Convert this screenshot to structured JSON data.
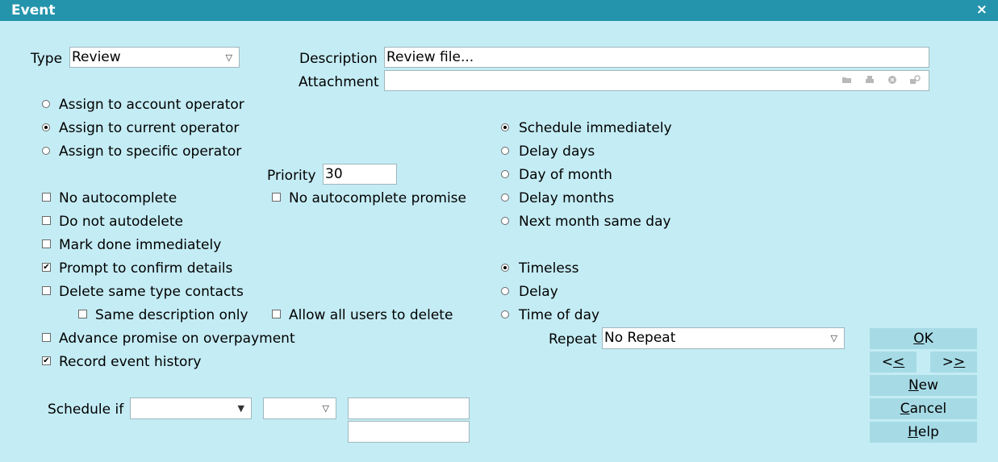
{
  "window": {
    "title": "Event",
    "close_glyph": "×"
  },
  "type": {
    "label": "Type",
    "value": "Review"
  },
  "description": {
    "label": "Description",
    "value": "Review file..."
  },
  "attachment": {
    "label": "Attachment",
    "value": "",
    "icons": [
      "folder-icon",
      "print-icon",
      "clear-icon",
      "search-icon"
    ]
  },
  "assign": [
    {
      "label": "Assign to account operator",
      "selected": false
    },
    {
      "label": "Assign to current operator",
      "selected": true
    },
    {
      "label": "Assign to specific operator",
      "selected": false
    }
  ],
  "priority": {
    "label": "Priority",
    "value": "30"
  },
  "options": {
    "no_autocomplete": {
      "label": "No autocomplete",
      "checked": false
    },
    "no_autocomplete_promise": {
      "label": "No autocomplete promise",
      "checked": false
    },
    "do_not_autodelete": {
      "label": "Do not autodelete",
      "checked": false
    },
    "mark_done": {
      "label": "Mark done immediately",
      "checked": false
    },
    "prompt_confirm": {
      "label": "Prompt to confirm details",
      "checked": true
    },
    "delete_same_type": {
      "label": "Delete same type contacts",
      "checked": false
    },
    "same_description": {
      "label": "Same description only",
      "checked": false
    },
    "allow_all_users": {
      "label": "Allow all users to delete",
      "checked": false
    },
    "advance_promise": {
      "label": "Advance promise on overpayment",
      "checked": false
    },
    "record_history": {
      "label": "Record event history",
      "checked": true
    }
  },
  "schedule": [
    {
      "label": "Schedule immediately",
      "selected": true
    },
    {
      "label": "Delay days",
      "selected": false
    },
    {
      "label": "Day of month",
      "selected": false
    },
    {
      "label": "Delay months",
      "selected": false
    },
    {
      "label": "Next month same day",
      "selected": false
    }
  ],
  "timing": [
    {
      "label": "Timeless",
      "selected": true
    },
    {
      "label": "Delay",
      "selected": false
    },
    {
      "label": "Time of day",
      "selected": false
    }
  ],
  "repeat": {
    "label": "Repeat",
    "value": "No Repeat"
  },
  "schedule_if": {
    "label": "Schedule if",
    "field1": "",
    "field2": "",
    "text1": "",
    "text2": ""
  },
  "buttons": {
    "ok": {
      "pre": "",
      "ul": "O",
      "post": "K"
    },
    "prev": {
      "pre": "<",
      "ul": "<",
      "post": ""
    },
    "next": {
      "pre": ">",
      "ul": ">",
      "post": ""
    },
    "new": {
      "pre": "",
      "ul": "N",
      "post": "ew"
    },
    "cancel": {
      "pre": "",
      "ul": "C",
      "post": "ancel"
    },
    "help": {
      "pre": "",
      "ul": "H",
      "post": "elp"
    }
  },
  "colors": {
    "titlebar": "#2494ac",
    "background": "#c4ecf4",
    "button": "#a6dbe6"
  }
}
